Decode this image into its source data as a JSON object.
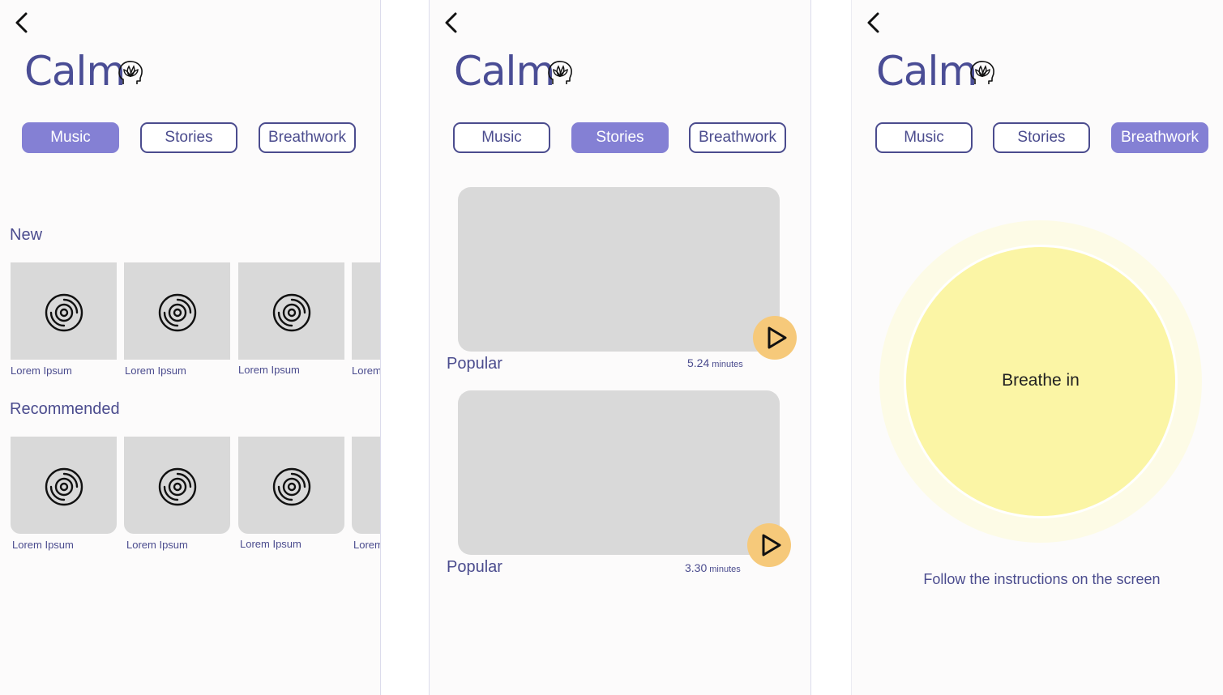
{
  "app": {
    "title": "Calm",
    "brand_icon": "lotus-head-icon",
    "back_icon": "chevron-left-icon"
  },
  "tabs": [
    "Music",
    "Stories",
    "Breathwork"
  ],
  "colors": {
    "primary": "#4b4c8e",
    "tab_active": "#8480d4",
    "placeholder": "#d9d9d9",
    "play_button": "#f6c97a",
    "breathe_inner": "#fbf5a5",
    "breathe_outer": "#fdfbe6"
  },
  "music": {
    "new_label": "New",
    "recommended_label": "Recommended",
    "new_items": [
      "Lorem Ipsum",
      "Lorem Ipsum",
      "Lorem Ipsum",
      "Lorem"
    ],
    "recommended_items": [
      "Lorem Ipsum",
      "Lorem Ipsum",
      "Lorem Ipsum",
      "Lorem"
    ],
    "item_icon": "vinyl-disc-icon"
  },
  "stories": {
    "items": [
      {
        "title": "Popular",
        "duration": "5.24",
        "unit": "minutes"
      },
      {
        "title": "Popular",
        "duration": "3.30",
        "unit": "minutes"
      }
    ],
    "play_icon": "play-icon"
  },
  "breathwork": {
    "prompt": "Breathe in",
    "instructions": "Follow the instructions on the screen"
  }
}
